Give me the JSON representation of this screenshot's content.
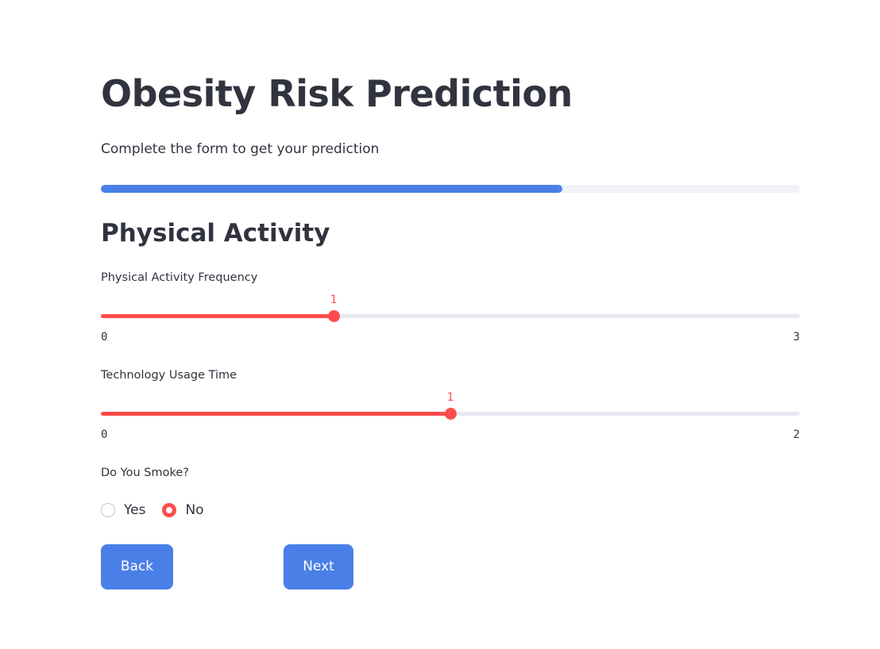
{
  "page": {
    "title": "Obesity Risk Prediction",
    "subtitle": "Complete the form to get your prediction",
    "progress_percent": 66
  },
  "section": {
    "title": "Physical Activity"
  },
  "fields": {
    "physical_activity_frequency": {
      "label": "Physical Activity Frequency",
      "value": 1,
      "min": 0,
      "max": 3,
      "value_label": "1",
      "min_label": "0",
      "max_label": "3"
    },
    "technology_usage_time": {
      "label": "Technology Usage Time",
      "value": 1,
      "min": 0,
      "max": 2,
      "value_label": "1",
      "min_label": "0",
      "max_label": "2"
    },
    "smoke": {
      "label": "Do You Smoke?",
      "options": [
        "Yes",
        "No"
      ],
      "selected": "No"
    }
  },
  "buttons": {
    "back_label": "Back",
    "next_label": "Next"
  },
  "colors": {
    "accent": "#ff4b4b",
    "primary": "#4a7fe8",
    "text": "#31333f",
    "track": "#e6e9ef"
  }
}
